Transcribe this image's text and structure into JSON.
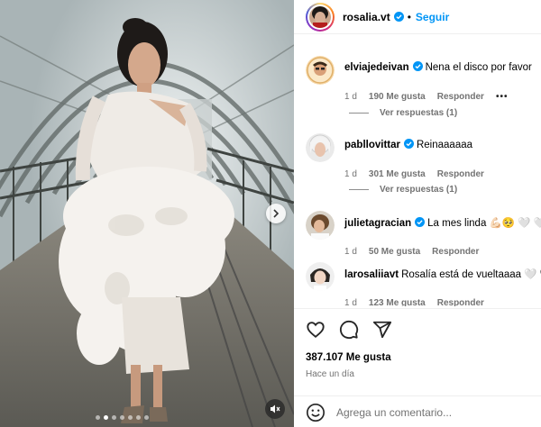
{
  "post": {
    "username": "rosalia.vt",
    "follow_label": "Seguir",
    "bullet": "•"
  },
  "comments": [
    {
      "username": "elviajedeivan",
      "verified": true,
      "text": "Nena el disco por favor",
      "time": "1 d",
      "likes": "190 Me gusta",
      "reply": "Responder",
      "more": "•••",
      "view_replies": "Ver respuestas (1)"
    },
    {
      "username": "pabllovittar",
      "verified": true,
      "text": "Reinaaaaaa",
      "time": "1 d",
      "likes": "301 Me gusta",
      "reply": "Responder",
      "view_replies": "Ver respuestas (1)"
    },
    {
      "username": "julietagracian",
      "verified": true,
      "text": "La mes linda 💪🏻🥺 🤍 🤍",
      "time": "1 d",
      "likes": "50 Me gusta",
      "reply": "Responder"
    },
    {
      "username": "larosaliiavt",
      "verified": false,
      "text": "Rosalía está de vueltaaaa 🤍 🖤",
      "time": "1 d",
      "likes": "123 Me gusta",
      "reply": "Responder"
    }
  ],
  "stats": {
    "likes_total": "387.107 Me gusta",
    "time_ago": "Hace un día"
  },
  "composer": {
    "placeholder": "Agrega un comentario..."
  },
  "carousel": {
    "count": 7,
    "active_index": 1
  },
  "colors": {
    "accent": "#0095f6",
    "verified": "#0095f6",
    "muted": "#737373"
  },
  "icons": {
    "like": "heart-icon",
    "comment": "comment-icon",
    "share": "share-icon",
    "emoji": "emoji-icon",
    "next": "chevron-right-icon",
    "mute": "mute-icon"
  }
}
